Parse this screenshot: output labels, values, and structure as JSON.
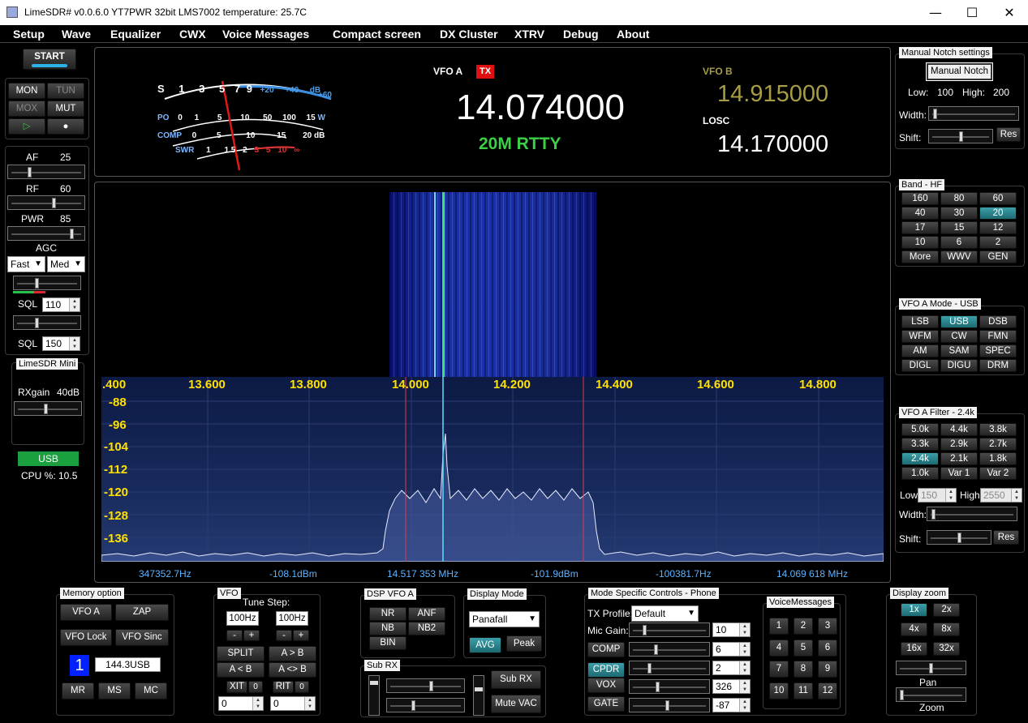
{
  "window": {
    "title": "LimeSDR# v0.0.6.0 YT7PWR 32bit   LMS7002 temperature: 25.7C",
    "min": "—",
    "max": "☐",
    "close": "✕"
  },
  "menu": [
    "Setup",
    "Wave",
    "Equalizer",
    "CWX",
    "Voice Messages",
    "Compact screen",
    "DX Cluster",
    "XTRV",
    "Debug",
    "About"
  ],
  "left": {
    "start": "START",
    "mon": "MON",
    "tun": "TUN",
    "mox": "MOX",
    "mut": "MUT",
    "af_label": "AF",
    "af_value": "25",
    "rf_label": "RF",
    "rf_value": "60",
    "pwr_label": "PWR",
    "pwr_value": "85",
    "agc_label": "AGC",
    "agc_mode": "Fast",
    "agc_speed": "Med",
    "sql_label": "SQL",
    "sql1": "110",
    "sql2": "150",
    "limesdr_caption": "LimeSDR Mini",
    "rxgain_label": "RXgain",
    "rxgain_value": "40dB",
    "mode": "USB",
    "cpu": "CPU %: 10.5"
  },
  "meter": {
    "s_scale": [
      "S",
      "1",
      "3",
      "5",
      "7",
      "9",
      "+20",
      "+40",
      "dB",
      "+60"
    ],
    "po_scale": [
      "PO",
      "0",
      "1",
      "5",
      "10",
      "50",
      "100",
      "15",
      "W"
    ],
    "comp_scale": [
      "COMP",
      "0",
      "5",
      "10",
      "15",
      "20",
      "dB"
    ],
    "swr_scale": [
      "SWR",
      "1",
      "1.5",
      "2",
      "3",
      "5",
      "10",
      "∞"
    ]
  },
  "vfo": {
    "a_label": "VFO A",
    "tx": "TX",
    "a_freq": "14.074000",
    "a_mode": "20M RTTY",
    "b_label": "VFO B",
    "b_freq": "14.915000",
    "losc_label": "LOSC",
    "losc_freq": "14.170000"
  },
  "spectrum": {
    "freq_ticks": [
      ".400",
      "13.600",
      "13.800",
      "14.000",
      "14.200",
      "14.400",
      "14.600",
      "14.800"
    ],
    "db_ticks": [
      "-88",
      "-96",
      "-104",
      "-112",
      "-120",
      "-128",
      "-136"
    ],
    "readouts": [
      "347352.7Hz",
      "-108.1dBm",
      "14.517 353 MHz",
      "-101.9dBm",
      "-100381.7Hz",
      "14.069 618 MHz"
    ]
  },
  "notch": {
    "caption": "Manual Notch settings",
    "button": "Manual Notch",
    "low_label": "Low:",
    "low": "100",
    "high_label": "High:",
    "high": "200",
    "width_label": "Width:",
    "shift_label": "Shift:",
    "res": "Res"
  },
  "band": {
    "caption": "Band - HF",
    "buttons": [
      "160",
      "80",
      "60",
      "40",
      "30",
      "20",
      "17",
      "15",
      "12",
      "10",
      "6",
      "2",
      "More",
      "WWV",
      "GEN"
    ],
    "selected": "20"
  },
  "vfo_mode": {
    "caption": "VFO A Mode - USB",
    "buttons": [
      "LSB",
      "USB",
      "DSB",
      "WFM",
      "CW",
      "FMN",
      "AM",
      "SAM",
      "SPEC",
      "DIGL",
      "DIGU",
      "DRM"
    ],
    "selected": "USB"
  },
  "filter": {
    "caption": "VFO A Filter - 2.4k",
    "buttons": [
      "5.0k",
      "4.4k",
      "3.8k",
      "3.3k",
      "2.9k",
      "2.7k",
      "2.4k",
      "2.1k",
      "1.8k",
      "1.0k",
      "Var 1",
      "Var 2"
    ],
    "selected": "2.4k",
    "low_label": "Low",
    "low": "150",
    "high_label": "High",
    "high": "2550",
    "width_label": "Width:",
    "shift_label": "Shift:",
    "res": "Res"
  },
  "memory": {
    "caption": "Memory option",
    "vfo_a": "VFO A",
    "zap": "ZAP",
    "vfo_lock": "VFO Lock",
    "vfo_sinc": "VFO Sinc",
    "channel": "1",
    "entry": "144.3USB",
    "mr": "MR",
    "ms": "MS",
    "mc": "MC"
  },
  "vfo_panel": {
    "caption": "VFO",
    "tune_step": "Tune Step:",
    "step1": "100Hz",
    "step2": "100Hz",
    "minus": "-",
    "plus": "+",
    "split": "SPLIT",
    "a_to_b": "A > B",
    "a_lt_b": "A < B",
    "a_swap_b": "A <> B",
    "xit": "XIT",
    "rit": "RIT",
    "zero": "0",
    "xit_value": "0",
    "rit_value": "0"
  },
  "dsp": {
    "caption": "DSP VFO A",
    "nr": "NR",
    "anf": "ANF",
    "nb": "NB",
    "nb2": "NB2",
    "bin": "BIN"
  },
  "display_mode": {
    "caption": "Display Mode",
    "value": "Panafall",
    "avg": "AVG",
    "peak": "Peak"
  },
  "subrx": {
    "caption": "Sub RX",
    "sub_rx": "Sub RX",
    "mute_vac": "Mute VAC"
  },
  "mode_specific": {
    "caption": "Mode Specific Controls - Phone",
    "tx_profile_label": "TX Profile:",
    "tx_profile": "Default",
    "mic_gain_label": "Mic Gain:",
    "mic_gain": "10",
    "comp": "COMP",
    "comp_value": "6",
    "cpdr": "CPDR",
    "cpdr_value": "2",
    "vox": "VOX",
    "vox_value": "326",
    "gate": "GATE",
    "gate_value": "-87"
  },
  "voice": {
    "caption": "VoiceMessages",
    "buttons": [
      "1",
      "2",
      "3",
      "4",
      "5",
      "6",
      "7",
      "8",
      "9",
      "10",
      "11",
      "12"
    ]
  },
  "zoom": {
    "caption": "Display zoom",
    "buttons": [
      "1x",
      "2x",
      "4x",
      "8x",
      "16x",
      "32x"
    ],
    "selected": "1x",
    "pan": "Pan",
    "zoom": "Zoom"
  }
}
